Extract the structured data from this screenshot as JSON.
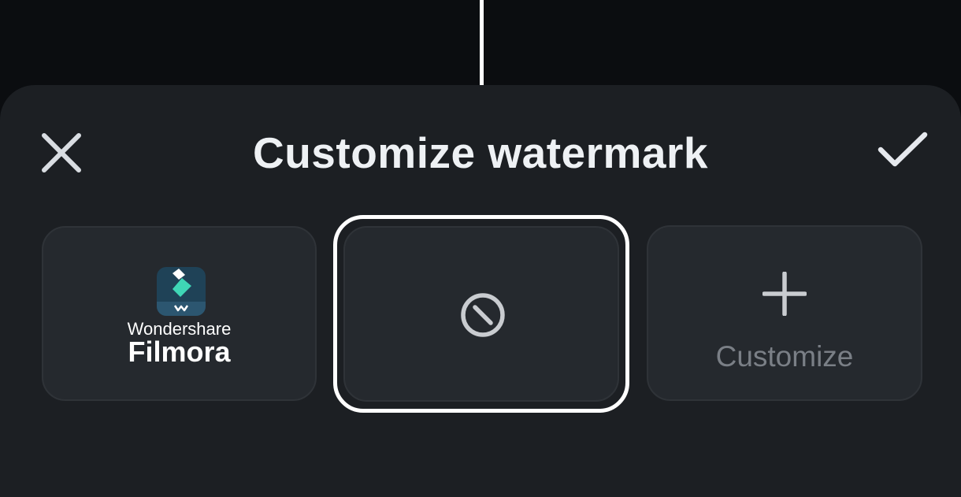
{
  "sheet": {
    "title": "Customize watermark",
    "close_icon": "close-icon",
    "confirm_icon": "check-icon"
  },
  "options": {
    "selected": "none",
    "items": [
      {
        "id": "filmora",
        "brand_caption": "Wondershare",
        "brand_name": "Filmora",
        "icon": "filmora-logo-icon"
      },
      {
        "id": "none",
        "icon": "no-watermark-icon"
      },
      {
        "id": "custom",
        "label": "Customize",
        "icon": "plus-icon"
      }
    ]
  },
  "colors": {
    "background": "#0b0d10",
    "sheet": "#1c1f23",
    "card": "#25292e",
    "selection": "#ffffff",
    "title_text": "#eef1f4",
    "muted_text": "#7a7f86",
    "logo_accent": "#3fd6b6"
  }
}
